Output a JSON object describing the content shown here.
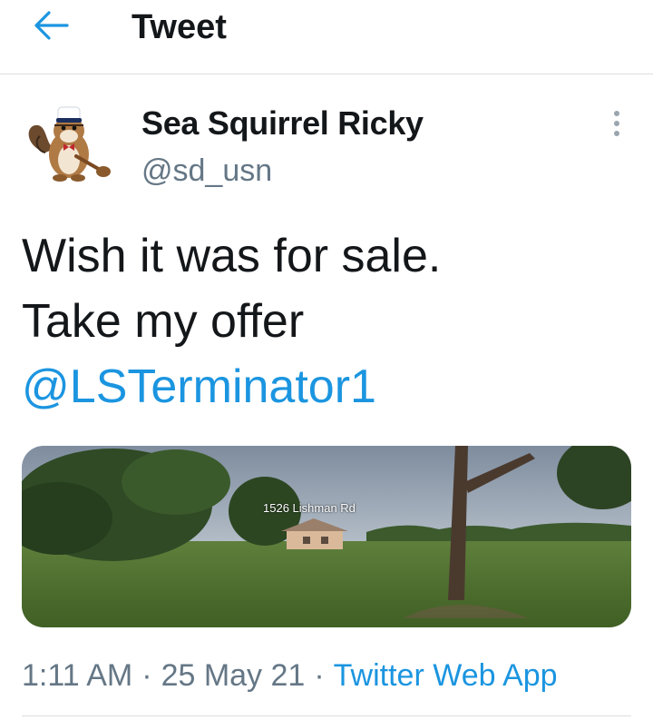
{
  "header": {
    "title": "Tweet",
    "back_icon": "arrow-left-icon",
    "accent": "#1b95e0"
  },
  "author": {
    "name": "Sea Squirrel Ricky",
    "handle": "@sd_usn",
    "avatar": "chipmunk-sailor-avatar"
  },
  "tweet": {
    "lines": [
      "Wish it was for sale.",
      "Take my offer"
    ],
    "mention": "@LSTerminator1",
    "media": {
      "caption": "1526 Lishman Rd",
      "description_icon": "street-view-photo"
    }
  },
  "meta": {
    "time": "1:11 AM",
    "date": "25 May 21",
    "source": "Twitter Web App",
    "separator": "·"
  },
  "colors": {
    "text": "#14171a",
    "secondary": "#657786",
    "link": "#1b95e0",
    "divider": "#d9dde0"
  }
}
